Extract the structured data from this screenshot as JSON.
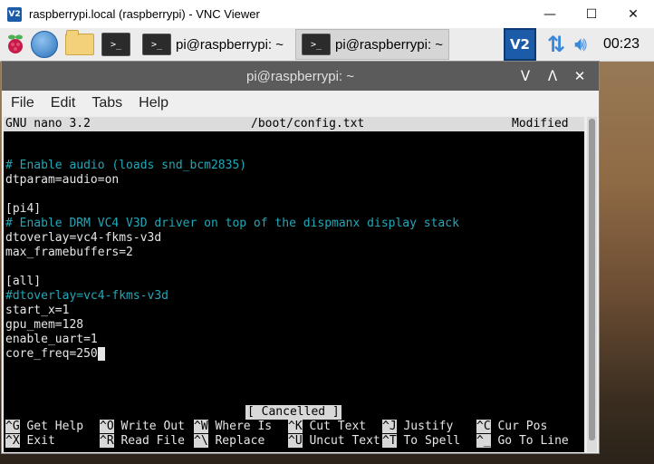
{
  "vnc": {
    "icon_text": "V2",
    "title": "raspberrypi.local (raspberrypi) - VNC Viewer",
    "controls": [
      "—",
      "☐",
      "✕"
    ]
  },
  "panel": {
    "tasks": [
      {
        "icon": ">_",
        "label": "pi@raspberrypi: ~"
      },
      {
        "icon": ">_",
        "label": "pi@raspberrypi: ~"
      }
    ],
    "vnc_tray": "V2",
    "clock": "00:23"
  },
  "terminal": {
    "title": "pi@raspberrypi: ~",
    "controls": [
      "ᐯ",
      "ᐱ",
      "✕"
    ],
    "menu": [
      "File",
      "Edit",
      "Tabs",
      "Help"
    ]
  },
  "nano": {
    "version": "GNU nano 3.2",
    "filename": "/boot/config.txt",
    "state": "Modified",
    "lines": [
      {
        "text": "# Enable audio (loads snd_bcm2835)",
        "kind": "comment"
      },
      {
        "text": "dtparam=audio=on",
        "kind": "text"
      },
      {
        "text": "",
        "kind": "text"
      },
      {
        "text": "[pi4]",
        "kind": "text"
      },
      {
        "text": "# Enable DRM VC4 V3D driver on top of the dispmanx display stack",
        "kind": "comment"
      },
      {
        "text": "dtoverlay=vc4-fkms-v3d",
        "kind": "text"
      },
      {
        "text": "max_framebuffers=2",
        "kind": "text"
      },
      {
        "text": "",
        "kind": "text"
      },
      {
        "text": "[all]",
        "kind": "text"
      },
      {
        "text": "#dtoverlay=vc4-fkms-v3d",
        "kind": "comment"
      },
      {
        "text": "start_x=1",
        "kind": "text"
      },
      {
        "text": "gpu_mem=128",
        "kind": "text"
      },
      {
        "text": "enable_uart=1",
        "kind": "text"
      },
      {
        "text": "core_freq=250",
        "kind": "text"
      }
    ],
    "status": "[ Cancelled ]",
    "shortcuts_row1": [
      {
        "key": "^G",
        "label": "Get Help"
      },
      {
        "key": "^O",
        "label": "Write Out"
      },
      {
        "key": "^W",
        "label": "Where Is"
      },
      {
        "key": "^K",
        "label": "Cut Text"
      },
      {
        "key": "^J",
        "label": "Justify"
      },
      {
        "key": "^C",
        "label": "Cur Pos"
      }
    ],
    "shortcuts_row2": [
      {
        "key": "^X",
        "label": "Exit"
      },
      {
        "key": "^R",
        "label": "Read File"
      },
      {
        "key": "^\\",
        "label": "Replace"
      },
      {
        "key": "^U",
        "label": "Uncut Text"
      },
      {
        "key": "^T",
        "label": "To Spell"
      },
      {
        "key": "^_",
        "label": "Go To Line"
      }
    ]
  }
}
